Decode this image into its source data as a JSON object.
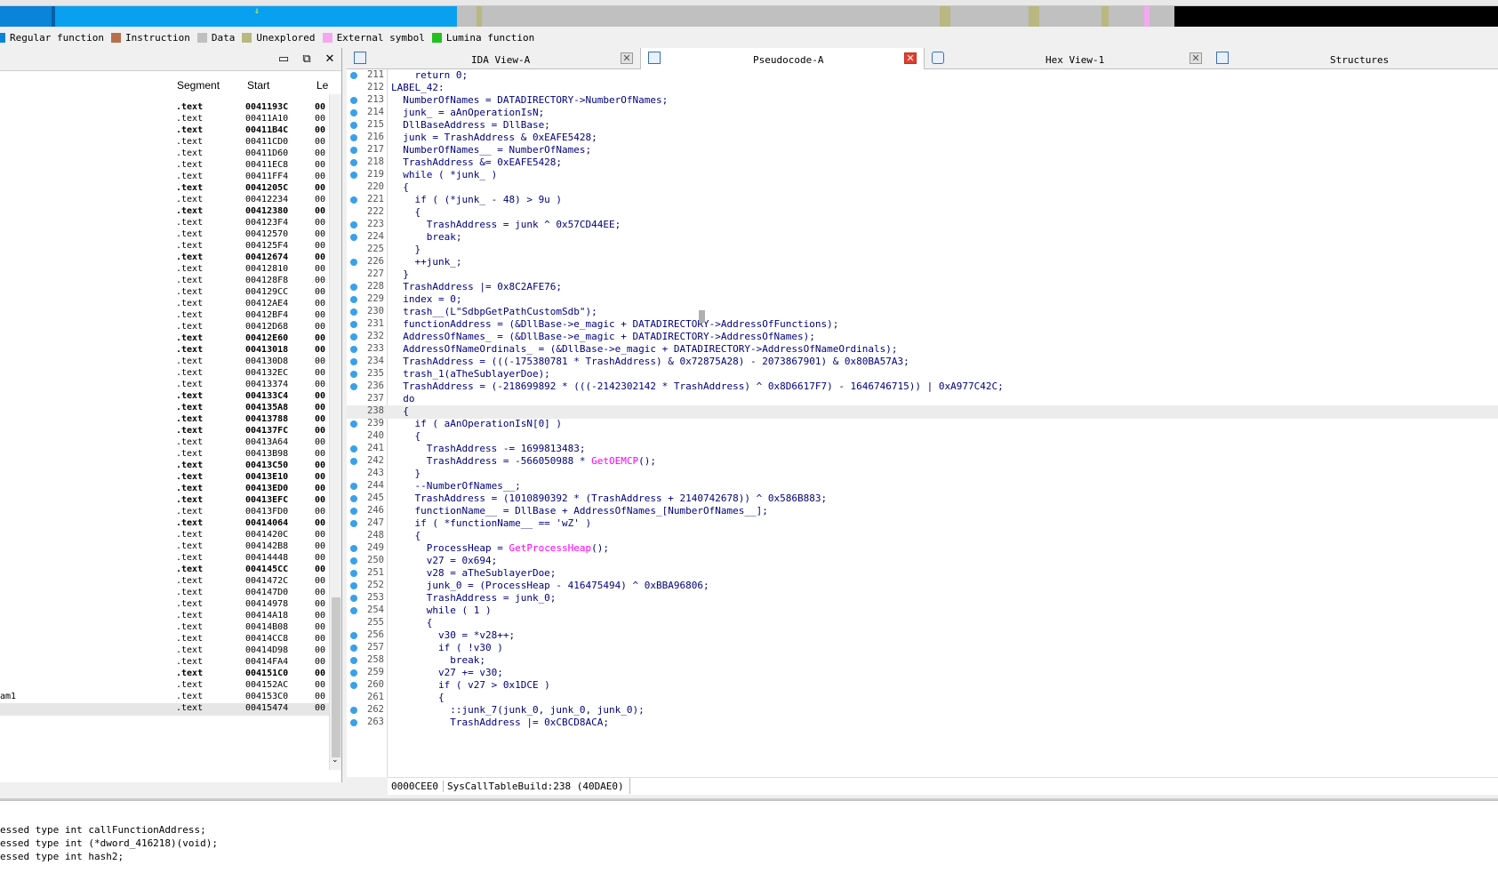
{
  "legend": [
    {
      "label": "Regular function",
      "color": "#0a84d8"
    },
    {
      "label": "Instruction",
      "color": "#b8704c"
    },
    {
      "label": "Data",
      "color": "#c0c0c0"
    },
    {
      "label": "Unexplored",
      "color": "#b8b880"
    },
    {
      "label": "External symbol",
      "color": "#f5a8f0"
    },
    {
      "label": "Lumina function",
      "color": "#22c020"
    }
  ],
  "segments_panel": {
    "columns": [
      "Segment",
      "Start",
      "Le"
    ],
    "rows": [
      {
        "seg": ".text",
        "start": "0041193C",
        "len": "00",
        "bold": true
      },
      {
        "seg": ".text",
        "start": "00411A10",
        "len": "00",
        "bold": false
      },
      {
        "seg": ".text",
        "start": "00411B4C",
        "len": "00",
        "bold": true
      },
      {
        "seg": ".text",
        "start": "00411CD0",
        "len": "00",
        "bold": false
      },
      {
        "seg": ".text",
        "start": "00411D60",
        "len": "00",
        "bold": false
      },
      {
        "seg": ".text",
        "start": "00411EC8",
        "len": "00",
        "bold": false
      },
      {
        "seg": ".text",
        "start": "00411FF4",
        "len": "00",
        "bold": false
      },
      {
        "seg": ".text",
        "start": "0041205C",
        "len": "00",
        "bold": true
      },
      {
        "seg": ".text",
        "start": "00412234",
        "len": "00",
        "bold": false
      },
      {
        "seg": ".text",
        "start": "00412380",
        "len": "00",
        "bold": true
      },
      {
        "seg": ".text",
        "start": "004123F4",
        "len": "00",
        "bold": false
      },
      {
        "seg": ".text",
        "start": "00412570",
        "len": "00",
        "bold": false
      },
      {
        "seg": ".text",
        "start": "004125F4",
        "len": "00",
        "bold": false
      },
      {
        "seg": ".text",
        "start": "00412674",
        "len": "00",
        "bold": true
      },
      {
        "seg": ".text",
        "start": "00412810",
        "len": "00",
        "bold": false
      },
      {
        "seg": ".text",
        "start": "004128F8",
        "len": "00",
        "bold": false
      },
      {
        "seg": ".text",
        "start": "004129CC",
        "len": "00",
        "bold": false
      },
      {
        "seg": ".text",
        "start": "00412AE4",
        "len": "00",
        "bold": false
      },
      {
        "seg": ".text",
        "start": "00412BF4",
        "len": "00",
        "bold": false
      },
      {
        "seg": ".text",
        "start": "00412D68",
        "len": "00",
        "bold": false
      },
      {
        "seg": ".text",
        "start": "00412E60",
        "len": "00",
        "bold": true
      },
      {
        "seg": ".text",
        "start": "00413018",
        "len": "00",
        "bold": true
      },
      {
        "seg": ".text",
        "start": "004130D8",
        "len": "00",
        "bold": false
      },
      {
        "seg": ".text",
        "start": "004132EC",
        "len": "00",
        "bold": false
      },
      {
        "seg": ".text",
        "start": "00413374",
        "len": "00",
        "bold": false
      },
      {
        "seg": ".text",
        "start": "004133C4",
        "len": "00",
        "bold": true
      },
      {
        "seg": ".text",
        "start": "004135A8",
        "len": "00",
        "bold": true
      },
      {
        "seg": ".text",
        "start": "00413788",
        "len": "00",
        "bold": true
      },
      {
        "seg": ".text",
        "start": "004137FC",
        "len": "00",
        "bold": true
      },
      {
        "seg": ".text",
        "start": "00413A64",
        "len": "00",
        "bold": false
      },
      {
        "seg": ".text",
        "start": "00413B98",
        "len": "00",
        "bold": false
      },
      {
        "seg": ".text",
        "start": "00413C50",
        "len": "00",
        "bold": true
      },
      {
        "seg": ".text",
        "start": "00413E10",
        "len": "00",
        "bold": true
      },
      {
        "seg": ".text",
        "start": "00413ED0",
        "len": "00",
        "bold": true
      },
      {
        "seg": ".text",
        "start": "00413EFC",
        "len": "00",
        "bold": true
      },
      {
        "seg": ".text",
        "start": "00413FD0",
        "len": "00",
        "bold": false
      },
      {
        "seg": ".text",
        "start": "00414064",
        "len": "00",
        "bold": true
      },
      {
        "seg": ".text",
        "start": "0041420C",
        "len": "00",
        "bold": false
      },
      {
        "seg": ".text",
        "start": "004142B8",
        "len": "00",
        "bold": false
      },
      {
        "seg": ".text",
        "start": "00414448",
        "len": "00",
        "bold": false
      },
      {
        "seg": ".text",
        "start": "004145CC",
        "len": "00",
        "bold": true
      },
      {
        "seg": ".text",
        "start": "0041472C",
        "len": "00",
        "bold": false
      },
      {
        "seg": ".text",
        "start": "004147D0",
        "len": "00",
        "bold": false
      },
      {
        "seg": ".text",
        "start": "00414978",
        "len": "00",
        "bold": false
      },
      {
        "seg": ".text",
        "start": "00414A18",
        "len": "00",
        "bold": false
      },
      {
        "seg": ".text",
        "start": "00414B08",
        "len": "00",
        "bold": false
      },
      {
        "seg": ".text",
        "start": "00414CC8",
        "len": "00",
        "bold": false
      },
      {
        "seg": ".text",
        "start": "00414D98",
        "len": "00",
        "bold": false
      },
      {
        "seg": ".text",
        "start": "00414FA4",
        "len": "00",
        "bold": false
      },
      {
        "seg": ".text",
        "start": "004151C0",
        "len": "00",
        "bold": true
      },
      {
        "seg": ".text",
        "start": "004152AC",
        "len": "00",
        "bold": false
      },
      {
        "seg": ".text",
        "start": "004153C0",
        "len": "00",
        "bold": false
      },
      {
        "seg": ".text",
        "start": "00415474",
        "len": "00",
        "bold": false
      }
    ],
    "row_prefix_text": "am1"
  },
  "tabs": [
    {
      "label": "IDA View-A",
      "active": false
    },
    {
      "label": "Pseudocode-A",
      "active": true
    },
    {
      "label": "Hex View-1",
      "active": false
    },
    {
      "label": "Structures",
      "active": false
    }
  ],
  "code_lines": [
    {
      "n": "211",
      "dot": true,
      "t": "    return 0;"
    },
    {
      "n": "212",
      "dot": false,
      "t": "LABEL_42:"
    },
    {
      "n": "213",
      "dot": true,
      "t": "  NumberOfNames = DATADIRECTORY->NumberOfNames;"
    },
    {
      "n": "214",
      "dot": true,
      "t": "  junk_ = aAnOperationIsN;"
    },
    {
      "n": "215",
      "dot": true,
      "t": "  DllBaseAddress = DllBase;"
    },
    {
      "n": "216",
      "dot": true,
      "t": "  junk = TrashAddress & 0xEAFE5428;"
    },
    {
      "n": "217",
      "dot": true,
      "t": "  NumberOfNames__ = NumberOfNames;"
    },
    {
      "n": "218",
      "dot": true,
      "t": "  TrashAddress &= 0xEAFE5428;"
    },
    {
      "n": "219",
      "dot": true,
      "t": "  while ( *junk_ )"
    },
    {
      "n": "220",
      "dot": false,
      "t": "  {"
    },
    {
      "n": "221",
      "dot": true,
      "t": "    if ( (*junk_ - 48) > 9u )"
    },
    {
      "n": "222",
      "dot": false,
      "t": "    {"
    },
    {
      "n": "223",
      "dot": true,
      "t": "      TrashAddress = junk ^ 0x57CD44EE;"
    },
    {
      "n": "224",
      "dot": true,
      "t": "      break;"
    },
    {
      "n": "225",
      "dot": false,
      "t": "    }"
    },
    {
      "n": "226",
      "dot": true,
      "t": "    ++junk_;"
    },
    {
      "n": "227",
      "dot": false,
      "t": "  }"
    },
    {
      "n": "228",
      "dot": true,
      "t": "  TrashAddress |= 0x8C2AFE76;"
    },
    {
      "n": "229",
      "dot": true,
      "t": "  index = 0;"
    },
    {
      "n": "230",
      "dot": true,
      "t": "  trash__(L\"SdbpGetPathCustomSdb\");"
    },
    {
      "n": "231",
      "dot": true,
      "t": "  functionAddress = (&DllBase->e_magic + DATADIRECTORY->AddressOfFunctions);"
    },
    {
      "n": "232",
      "dot": true,
      "t": "  AddressOfNames_ = (&DllBase->e_magic + DATADIRECTORY->AddressOfNames);"
    },
    {
      "n": "233",
      "dot": true,
      "t": "  AddressOfNameOrdinals_ = (&DllBase->e_magic + DATADIRECTORY->AddressOfNameOrdinals);"
    },
    {
      "n": "234",
      "dot": true,
      "t": "  TrashAddress = (((-175380781 * TrashAddress) & 0x72875A28) - 2073867901) & 0x80BA57A3;"
    },
    {
      "n": "235",
      "dot": true,
      "t": "  trash_1(aTheSublayerDoe);"
    },
    {
      "n": "236",
      "dot": true,
      "t": "  TrashAddress = (-218699892 * (((-2142302142 * TrashAddress) ^ 0x8D6617F7) - 1646746715)) | 0xA977C42C;"
    },
    {
      "n": "237",
      "dot": false,
      "t": "  do"
    },
    {
      "n": "238",
      "dot": false,
      "t": "  {"
    },
    {
      "n": "239",
      "dot": true,
      "t": "    if ( aAnOperationIsN[0] )"
    },
    {
      "n": "240",
      "dot": false,
      "t": "    {"
    },
    {
      "n": "241",
      "dot": true,
      "t": "      TrashAddress -= 1699813483;"
    },
    {
      "n": "242",
      "dot": true,
      "t": "      TrashAddress = -566050988 * GetOEMCP();"
    },
    {
      "n": "243",
      "dot": false,
      "t": "    }"
    },
    {
      "n": "244",
      "dot": true,
      "t": "    --NumberOfNames__;"
    },
    {
      "n": "245",
      "dot": true,
      "t": "    TrashAddress = (1010890392 * (TrashAddress + 2140742678)) ^ 0x586B883;"
    },
    {
      "n": "246",
      "dot": true,
      "t": "    functionName__ = DllBase + AddressOfNames_[NumberOfNames__];"
    },
    {
      "n": "247",
      "dot": true,
      "t": "    if ( *functionName__ == 'wZ' )"
    },
    {
      "n": "248",
      "dot": false,
      "t": "    {"
    },
    {
      "n": "249",
      "dot": true,
      "t": "      ProcessHeap = GetProcessHeap();"
    },
    {
      "n": "250",
      "dot": true,
      "t": "      v27 = 0x694;"
    },
    {
      "n": "251",
      "dot": true,
      "t": "      v28 = aTheSublayerDoe;"
    },
    {
      "n": "252",
      "dot": true,
      "t": "      junk_0 = (ProcessHeap - 416475494) ^ 0xBBA96806;"
    },
    {
      "n": "253",
      "dot": true,
      "t": "      TrashAddress = junk_0;"
    },
    {
      "n": "254",
      "dot": true,
      "t": "      while ( 1 )"
    },
    {
      "n": "255",
      "dot": false,
      "t": "      {"
    },
    {
      "n": "256",
      "dot": true,
      "t": "        v30 = *v28++;"
    },
    {
      "n": "257",
      "dot": true,
      "t": "        if ( !v30 )"
    },
    {
      "n": "258",
      "dot": true,
      "t": "          break;"
    },
    {
      "n": "259",
      "dot": true,
      "t": "        v27 += v30;"
    },
    {
      "n": "260",
      "dot": true,
      "t": "        if ( v27 > 0x1DCE )"
    },
    {
      "n": "261",
      "dot": false,
      "t": "        {"
    },
    {
      "n": "262",
      "dot": true,
      "t": "          ::junk_7(junk_0, junk_0, junk_0);"
    },
    {
      "n": "263",
      "dot": true,
      "t": "          TrashAddress |= 0xCBCD8ACA;"
    }
  ],
  "status_bar": {
    "offset": "0000CEE0",
    "location": "SysCallTableBuild:238 (40DAE0)"
  },
  "output_lines": [
    "essed type int callFunctionAddress;",
    "essed type int (*dword_416218)(void);",
    "essed type int hash2;"
  ]
}
